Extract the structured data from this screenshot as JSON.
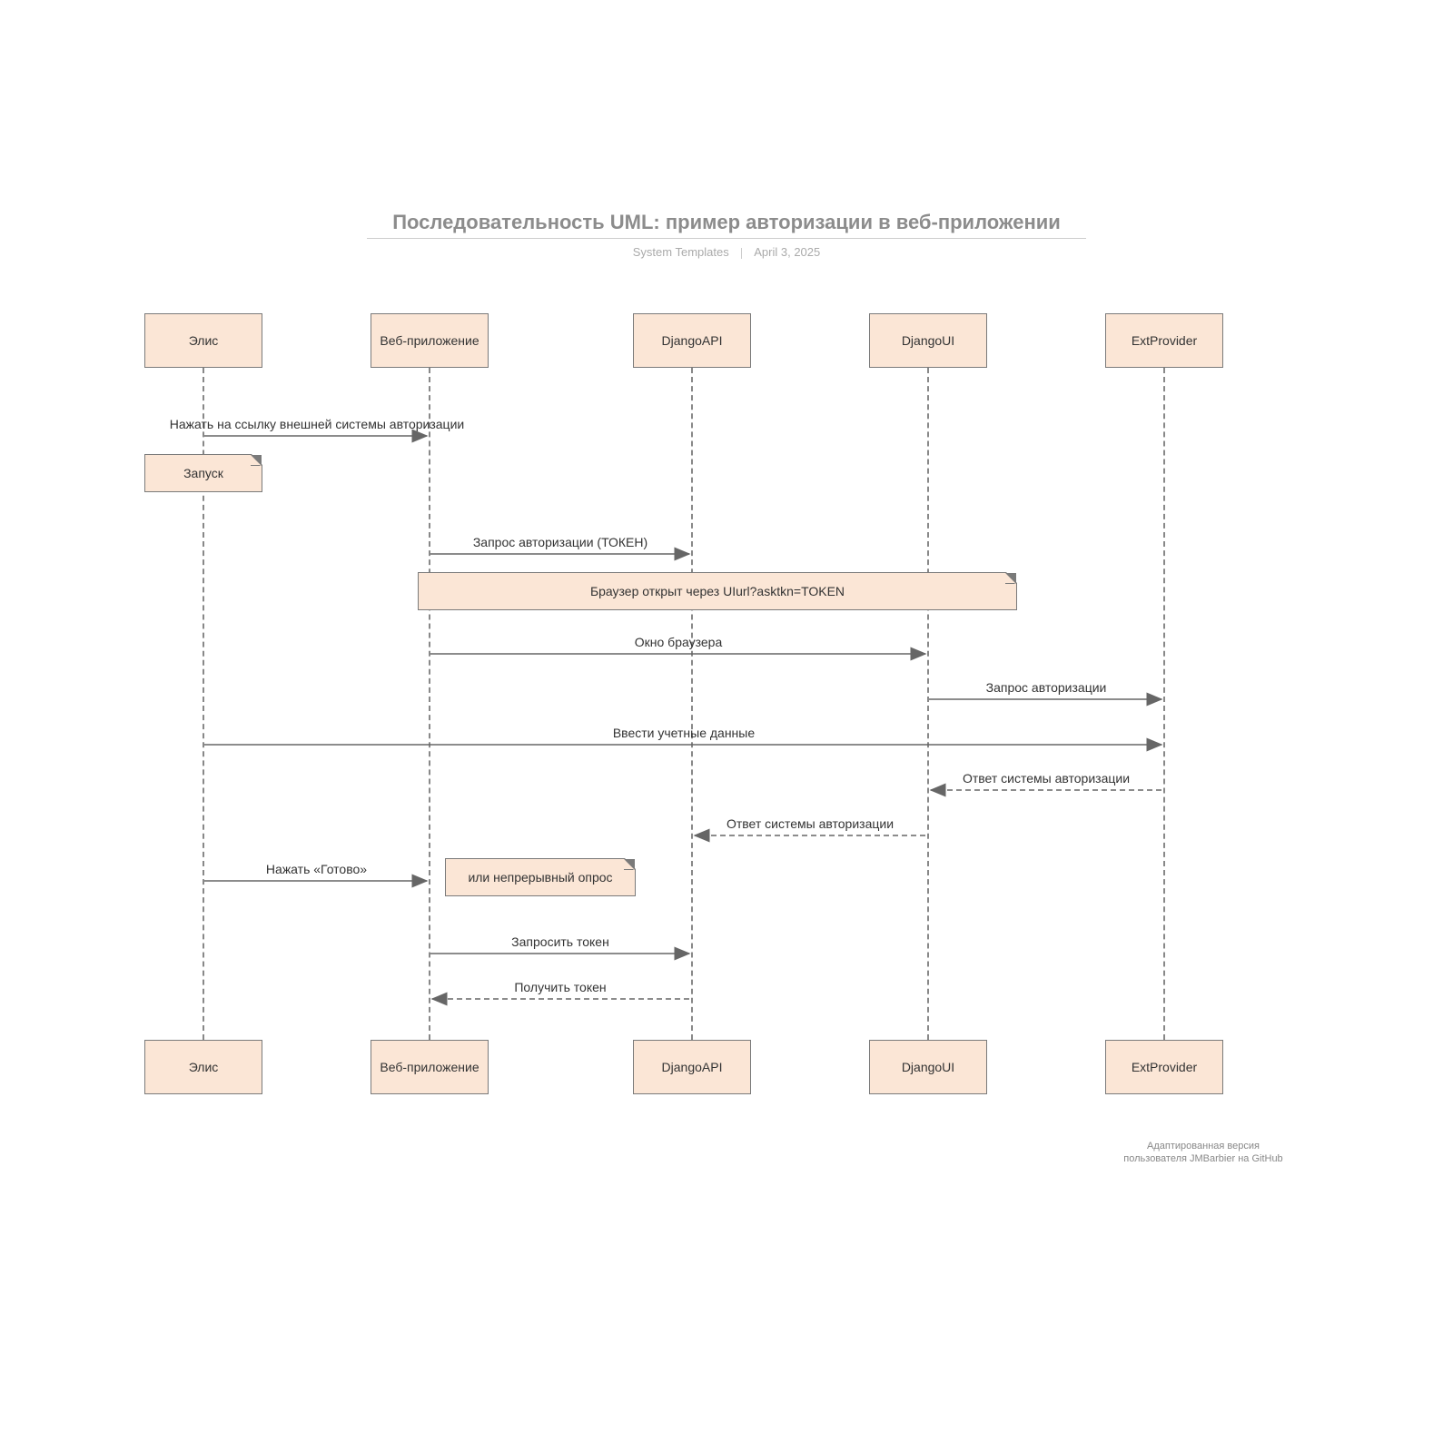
{
  "title": "Последовательность UML: пример авторизации в веб-приложении",
  "subtitle_left": "System Templates",
  "subtitle_right": "April 3, 2025",
  "participants": {
    "p1": "Элис",
    "p2": "Веб-приложение",
    "p3": "DjangoAPI",
    "p4": "DjangoUI",
    "p5": "ExtProvider"
  },
  "notes": {
    "start": "Запуск",
    "browser": "Браузер открыт через UIurl?asktkn=TOKEN",
    "poll": "или непрерывный опрос"
  },
  "messages": {
    "m1": "Нажать на ссылку внешней системы авторизации",
    "m2": "Запрос авторизации (ТОКЕН)",
    "m3": "Окно браузера",
    "m4": "Запрос авторизации",
    "m5": "Ввести учетные данные",
    "m6": "Ответ системы авторизации",
    "m7": "Ответ системы авторизации",
    "m8": "Нажать «Готово»",
    "m9": "Запросить токен",
    "m10": "Получить токен"
  },
  "credit_l1": "Адаптированная версия",
  "credit_l2": "пользователя JMBarbier на GitHub",
  "chart_data": {
    "type": "uml-sequence",
    "title": "Последовательность UML: пример авторизации в веб-приложении",
    "participants": [
      "Элис",
      "Веб-приложение",
      "DjangoAPI",
      "DjangoUI",
      "ExtProvider"
    ],
    "messages": [
      {
        "from": "Элис",
        "to": "Веб-приложение",
        "label": "Нажать на ссылку внешней системы авторизации",
        "dir": "→"
      },
      {
        "note": "Запуск",
        "over": [
          "Элис"
        ]
      },
      {
        "from": "Веб-приложение",
        "to": "DjangoAPI",
        "label": "Запрос авторизации (ТОКЕН)",
        "dir": "→"
      },
      {
        "note": "Браузер открыт через UIurl?asktkn=TOKEN",
        "over": [
          "Веб-приложение",
          "DjangoAPI",
          "DjangoUI"
        ]
      },
      {
        "from": "Веб-приложение",
        "to": "DjangoUI",
        "label": "Окно браузера",
        "dir": "→"
      },
      {
        "from": "DjangoUI",
        "to": "ExtProvider",
        "label": "Запрос авторизации",
        "dir": "→"
      },
      {
        "from": "Элис",
        "to": "ExtProvider",
        "label": "Ввести учетные данные",
        "dir": "→"
      },
      {
        "from": "ExtProvider",
        "to": "DjangoUI",
        "label": "Ответ системы авторизации",
        "dir": "←"
      },
      {
        "from": "DjangoUI",
        "to": "DjangoAPI",
        "label": "Ответ системы авторизации",
        "dir": "←"
      },
      {
        "from": "Элис",
        "to": "Веб-приложение",
        "label": "Нажать «Готово»",
        "dir": "→"
      },
      {
        "note": "или непрерывный опрос",
        "over": [
          "Веб-приложение"
        ]
      },
      {
        "from": "Веб-приложение",
        "to": "DjangoAPI",
        "label": "Запросить токен",
        "dir": "→"
      },
      {
        "from": "DjangoAPI",
        "to": "Веб-приложение",
        "label": "Получить токен",
        "dir": "←"
      }
    ]
  }
}
